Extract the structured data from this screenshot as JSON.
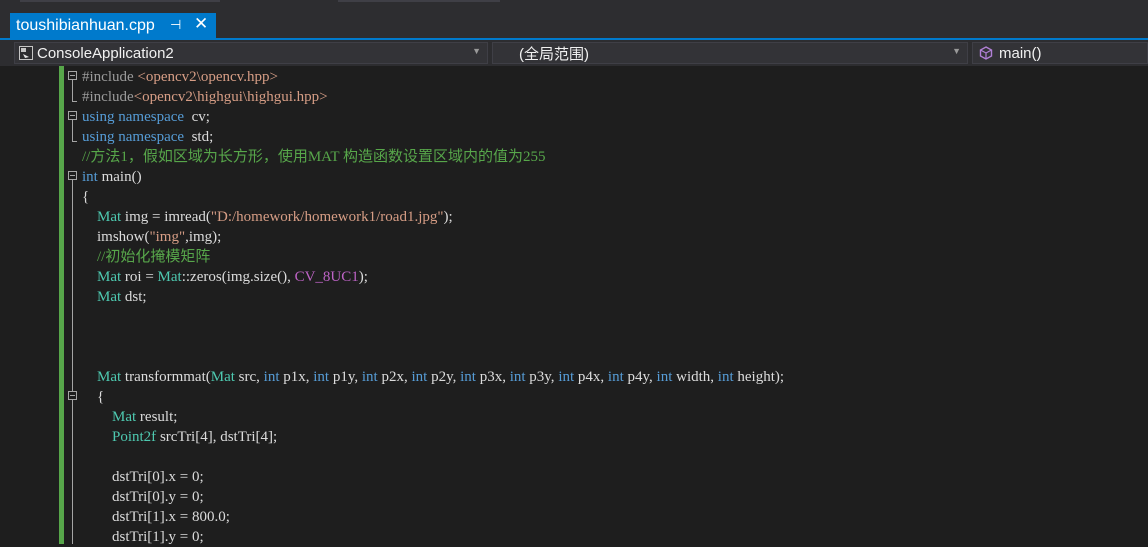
{
  "tab": {
    "title": "toushibianhuan.cpp",
    "pin_glyph": "⊣",
    "close_glyph": "✕"
  },
  "navbar": {
    "project": "ConsoleApplication2",
    "scope": "(全局范围)",
    "member": "main()"
  },
  "code_lines": [
    [
      [
        "pp",
        "#include "
      ],
      [
        "st",
        "<opencv2\\opencv.hpp>"
      ]
    ],
    [
      [
        "pp",
        "#include"
      ],
      [
        "st",
        "<opencv2\\highgui\\highgui.hpp>"
      ]
    ],
    [
      [
        "kw",
        "using namespace"
      ],
      [
        "",
        "  cv;"
      ]
    ],
    [
      [
        "kw",
        "using namespace"
      ],
      [
        "",
        "  std;"
      ]
    ],
    [
      [
        "cm",
        "//方法1，假如区域为长方形，使用MAT 构造函数设置区域内的值为255"
      ]
    ],
    [
      [
        "kw",
        "int"
      ],
      [
        "",
        " main()"
      ]
    ],
    [
      [
        "",
        "{"
      ]
    ],
    [
      [
        "ty",
        "    Mat"
      ],
      [
        "",
        " img = imread("
      ],
      [
        "st",
        "\"D:/homework/homework1/road1.jpg\""
      ],
      [
        "",
        ");"
      ]
    ],
    [
      [
        "",
        "    imshow("
      ],
      [
        "st",
        "\"img\""
      ],
      [
        "",
        ",img);"
      ]
    ],
    [
      [
        "cm",
        "    //初始化掩模矩阵"
      ]
    ],
    [
      [
        "ty",
        "    Mat"
      ],
      [
        "",
        " roi = "
      ],
      [
        "ty",
        "Mat"
      ],
      [
        "",
        "::zeros(img.size(), "
      ],
      [
        "ma",
        "CV_8UC1"
      ],
      [
        "",
        ");"
      ]
    ],
    [
      [
        "ty",
        "    Mat"
      ],
      [
        "",
        " dst;"
      ]
    ],
    [
      [
        "",
        ""
      ]
    ],
    [
      [
        "",
        ""
      ]
    ],
    [
      [
        "",
        ""
      ]
    ],
    [
      [
        "ty",
        "    Mat"
      ],
      [
        "",
        " transformmat("
      ],
      [
        "ty",
        "Mat"
      ],
      [
        "",
        " src, "
      ],
      [
        "kw",
        "int"
      ],
      [
        "",
        " p1x, "
      ],
      [
        "kw",
        "int"
      ],
      [
        "",
        " p1y, "
      ],
      [
        "kw",
        "int"
      ],
      [
        "",
        " p2x, "
      ],
      [
        "kw",
        "int"
      ],
      [
        "",
        " p2y, "
      ],
      [
        "kw",
        "int"
      ],
      [
        "",
        " p3x, "
      ],
      [
        "kw",
        "int"
      ],
      [
        "",
        " p3y, "
      ],
      [
        "kw",
        "int"
      ],
      [
        "",
        " p4x, "
      ],
      [
        "kw",
        "int"
      ],
      [
        "",
        " p4y, "
      ],
      [
        "kw",
        "int"
      ],
      [
        "",
        " width, "
      ],
      [
        "kw",
        "int"
      ],
      [
        "",
        " height);"
      ]
    ],
    [
      [
        "",
        "    {"
      ]
    ],
    [
      [
        "ty",
        "        Mat"
      ],
      [
        "",
        " result;"
      ]
    ],
    [
      [
        "ty",
        "        Point2f"
      ],
      [
        "",
        " srcTri[4], dstTri[4];"
      ]
    ],
    [
      [
        "",
        ""
      ]
    ],
    [
      [
        "",
        "        dstTri[0].x = 0;"
      ]
    ],
    [
      [
        "",
        "        dstTri[0].y = 0;"
      ]
    ],
    [
      [
        "",
        "        dstTri[1].x = 800.0;"
      ]
    ],
    [
      [
        "",
        "        dstTri[1].y = 0;"
      ]
    ]
  ],
  "colors": {
    "accent": "#007acc",
    "change_bar": "#57a64a",
    "keyword": "#569cd6",
    "type": "#4ec9b0",
    "string": "#d69d85",
    "comment": "#57a64a",
    "macro": "#bd63c5"
  }
}
